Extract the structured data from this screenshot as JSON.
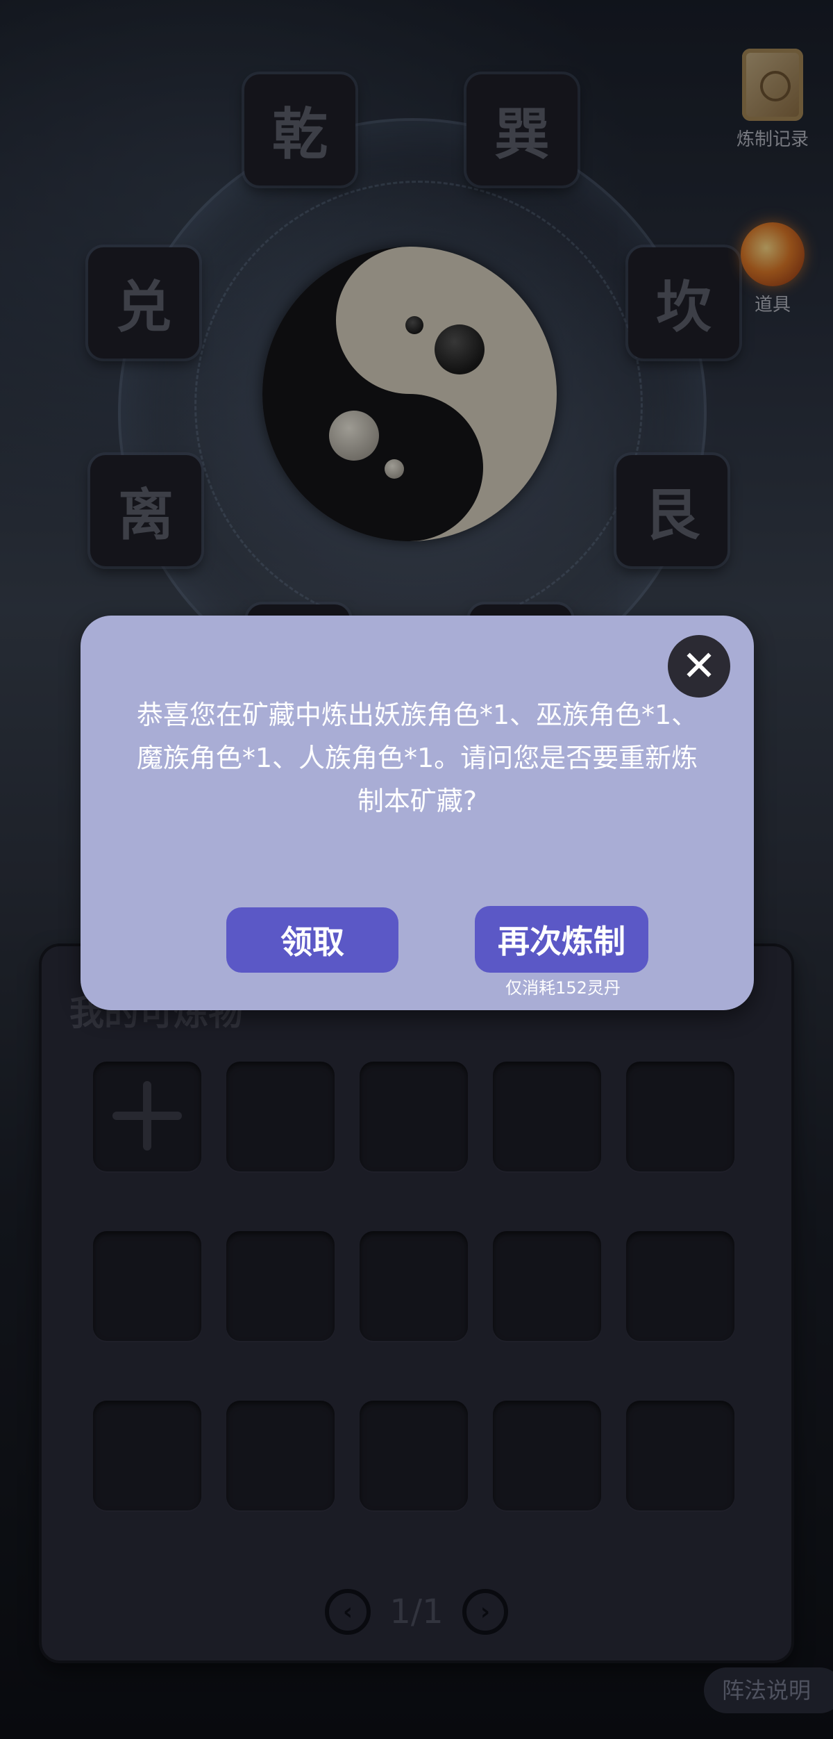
{
  "trigrams": {
    "qian": "乾",
    "xun": "巽",
    "dui": "兑",
    "kan": "坎",
    "li": "离",
    "gen": "艮"
  },
  "side_buttons": {
    "records_label": "炼制记录",
    "records_icon": "scroll-icon",
    "props_label": "道具",
    "props_icon": "gourd-icon"
  },
  "panel": {
    "title": "我的可炼物",
    "add_icon": "plus-icon",
    "page_indicator": "1/1",
    "prev_icon": "chevron-left-icon",
    "next_icon": "chevron-right-icon"
  },
  "array_help_label": "阵法说明",
  "dialog": {
    "message": "恭喜您在矿藏中炼出妖族角色*1、巫族角色*1、魔族角色*1、人族角色*1。请问您是否要重新炼制本矿藏?",
    "claim_label": "领取",
    "refine_again_label": "再次炼制",
    "cost_note": "仅消耗152灵丹",
    "close_icon": "close-icon"
  },
  "colors": {
    "dialog_bg": "#a9add5",
    "button_bg": "#5b58c6",
    "panel_bg": "#2a2b3a"
  }
}
